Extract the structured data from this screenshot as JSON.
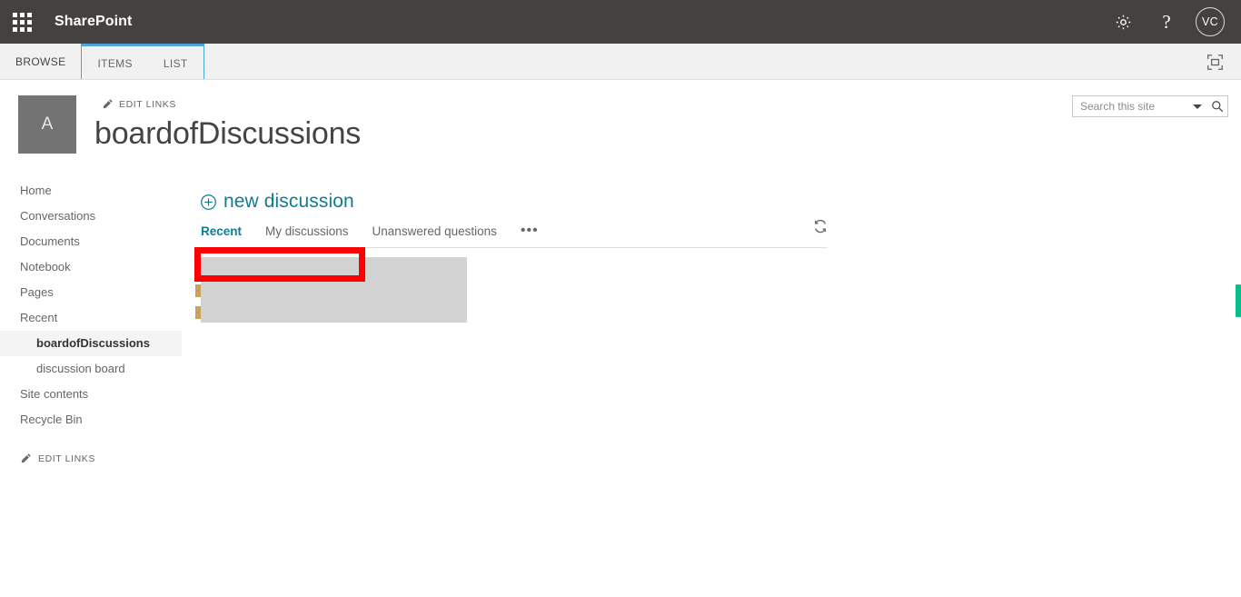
{
  "suite": {
    "waffle_icon": "app-launcher-waffle-icon",
    "brand": "SharePoint",
    "settings_icon": "gear-icon",
    "help_icon": "question-mark-icon",
    "help_glyph": "?",
    "avatar_initials": "VC",
    "brand_bar_color": "#45413e"
  },
  "ribbon": {
    "tabs": [
      {
        "label": "BROWSE",
        "contextual": false,
        "active": false
      },
      {
        "label": "ITEMS",
        "contextual": true,
        "active": true
      },
      {
        "label": "LIST",
        "contextual": true,
        "active": false
      }
    ],
    "contextual_accent_color": "#4ea6d6",
    "focus_on_content_icon": "focus-on-content-icon",
    "background_color": "#f1f1f1"
  },
  "site_header": {
    "logo_letter": "A",
    "logo_color": "#737373",
    "edit_links_label": "EDIT LINKS",
    "edit_links_icon": "pencil-icon",
    "title": "boardofDiscussions"
  },
  "search": {
    "placeholder": "Search this site",
    "value": "",
    "dropdown_icon": "chevron-down-icon",
    "search_icon": "magnifier-icon"
  },
  "quicklaunch": {
    "items": [
      {
        "label": "Home",
        "child": false,
        "selected": false
      },
      {
        "label": "Conversations",
        "child": false,
        "selected": false
      },
      {
        "label": "Documents",
        "child": false,
        "selected": false
      },
      {
        "label": "Notebook",
        "child": false,
        "selected": false
      },
      {
        "label": "Pages",
        "child": false,
        "selected": false
      },
      {
        "label": "Recent",
        "child": false,
        "selected": false
      },
      {
        "label": "boardofDiscussions",
        "child": true,
        "selected": true
      },
      {
        "label": "discussion board",
        "child": true,
        "selected": false
      },
      {
        "label": "Site contents",
        "child": false,
        "selected": false
      },
      {
        "label": "Recycle Bin",
        "child": false,
        "selected": false
      }
    ],
    "edit_links_label": "EDIT LINKS",
    "edit_links_icon": "pencil-icon"
  },
  "main": {
    "new_discussion_label": "new discussion",
    "new_discussion_icon": "plus-circle-icon",
    "accent_color": "#0f7c91",
    "view_tabs": [
      {
        "label": "Recent",
        "active": true
      },
      {
        "label": "My discussions",
        "active": false
      },
      {
        "label": "Unanswered questions",
        "active": false
      },
      {
        "label": "•••",
        "active": false
      }
    ],
    "refresh_icon": "refresh-icon",
    "redaction_block_color": "#d2d2d2",
    "annotation_color": "#fe0000",
    "scroll_indicator_color": "#06c08b"
  }
}
